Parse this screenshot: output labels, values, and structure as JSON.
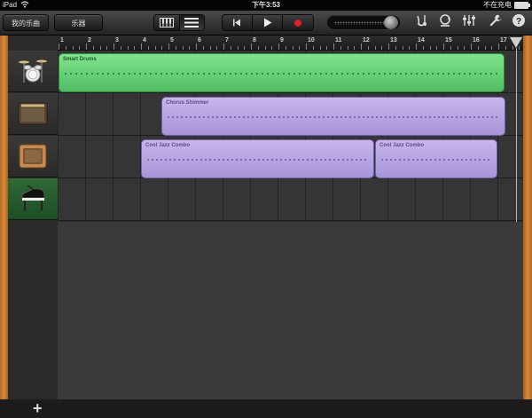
{
  "status": {
    "device": "iPad",
    "time": "下午3:53",
    "charging": "不在充电"
  },
  "toolbar": {
    "my_songs": "我的乐曲",
    "instruments": "乐器",
    "view_instrument_icon": "piano-keys-icon",
    "view_tracks_icon": "tracks-list-icon",
    "rewind_icon": "rewind-icon",
    "play_icon": "play-icon",
    "record_icon": "record-icon",
    "record_color": "#e0202a",
    "volume_level": 0.92,
    "metronome_icon": "metronome-icon",
    "loop_icon": "loop-icon",
    "mixer_icon": "mixer-icon",
    "settings_icon": "wrench-icon",
    "help_icon": "help-icon",
    "help_glyph": "?"
  },
  "ruler": {
    "bars": [
      "1",
      "2",
      "3",
      "4",
      "5",
      "6",
      "7",
      "8",
      "9",
      "10",
      "11",
      "12",
      "13",
      "14",
      "15",
      "16",
      "17"
    ]
  },
  "tracks": [
    {
      "instrument_icon": "drum-kit-icon",
      "regions": [
        {
          "name": "Smart Drums",
          "color": "#6cd17a"
        }
      ]
    },
    {
      "instrument_icon": "guitar-amp-icon",
      "regions": [
        {
          "name": "Chorus Shimmer",
          "color": "#b8a6e3"
        }
      ]
    },
    {
      "instrument_icon": "vintage-amp-icon",
      "regions": [
        {
          "name": "Cool Jazz Combo",
          "color": "#b8a6e3"
        },
        {
          "name": "Cool Jazz Combo",
          "color": "#b8a6e3"
        }
      ]
    },
    {
      "instrument_icon": "grand-piano-icon",
      "regions": []
    }
  ],
  "add_track": "+"
}
